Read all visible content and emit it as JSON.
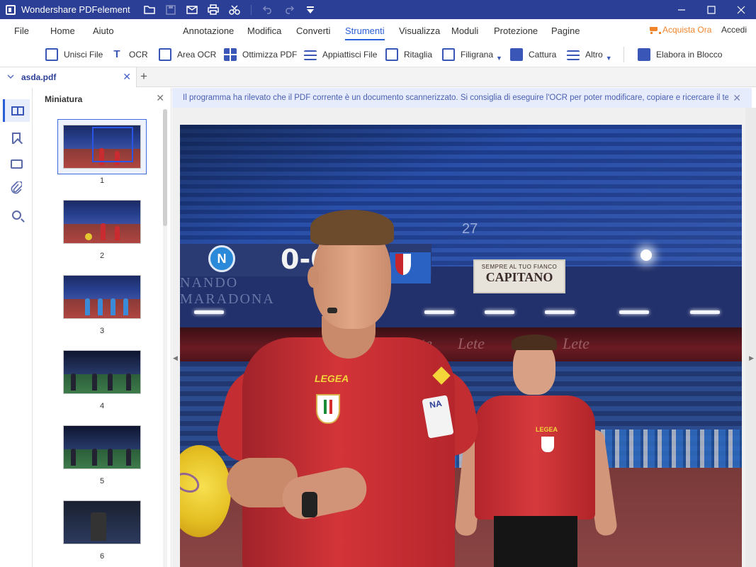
{
  "app": {
    "title": "Wondershare PDFelement"
  },
  "quick_access": {
    "icons": [
      "open-folder-icon",
      "save-icon",
      "email-icon",
      "print-icon",
      "cut-icon",
      "undo-icon",
      "redo-icon",
      "customize-icon"
    ]
  },
  "menu": {
    "items": [
      "File",
      "Home",
      "Aiuto",
      "Annotazione",
      "Modifica",
      "Converti",
      "Strumenti",
      "Visualizza",
      "Moduli",
      "Protezione",
      "Pagine"
    ],
    "active": "Strumenti",
    "buy_label": "Acquista Ora",
    "login_label": "Accedi"
  },
  "toolbar": {
    "tools": [
      {
        "label": "Unisci File",
        "icon": "merge-icon"
      },
      {
        "label": "OCR",
        "icon": "ocr-icon"
      },
      {
        "label": "Area OCR",
        "icon": "area-ocr-icon"
      },
      {
        "label": "Ottimizza PDF",
        "icon": "optimize-icon"
      },
      {
        "label": "Appiattisci File",
        "icon": "flatten-icon"
      },
      {
        "label": "Ritaglia",
        "icon": "crop-icon"
      },
      {
        "label": "Filigrana",
        "icon": "watermark-icon"
      },
      {
        "label": "Cattura",
        "icon": "capture-icon"
      },
      {
        "label": "Altro",
        "icon": "more-icon"
      },
      {
        "label": "Elabora in Blocco",
        "icon": "batch-icon"
      }
    ]
  },
  "tabs": {
    "document": "asda.pdf"
  },
  "sidebar": {
    "panel_title": "Miniatura",
    "rail_icons": [
      "thumbnails-icon",
      "bookmark-icon",
      "comment-icon",
      "attachment-icon",
      "search-icon"
    ],
    "pages": [
      {
        "number": "1",
        "selected": true
      },
      {
        "number": "2",
        "selected": false
      },
      {
        "number": "3",
        "selected": false
      },
      {
        "number": "4",
        "selected": false
      },
      {
        "number": "5",
        "selected": false
      },
      {
        "number": "6",
        "selected": false
      }
    ]
  },
  "banner": {
    "text": "Il programma ha rilevato che il PDF corrente è un documento scannerizzato. Si consiglia di eseguire l'OCR per poter modificare, copiare e ricercare il testo conte"
  },
  "page_content": {
    "score": "0-0",
    "napoli_letter": "N",
    "banner_small": "SEMPRE AL TUO FIANCO",
    "banner_big": "CAPITANO",
    "stadium_text": "NANDO MARADONA",
    "stand_number": "27",
    "ad_text": "Lete",
    "shirt_brand": "LEGEA",
    "sleeve_patch": "NA"
  },
  "colors": {
    "titlebar": "#2b3f97",
    "accent": "#2b5fd9",
    "buy": "#f0852d",
    "banner_bg": "#e6ecfb"
  }
}
